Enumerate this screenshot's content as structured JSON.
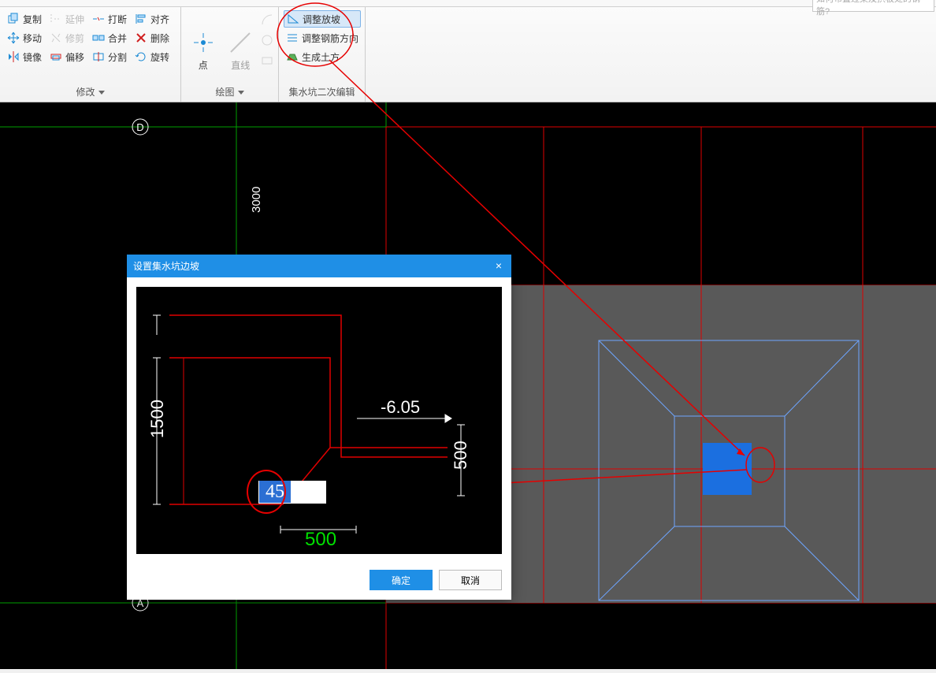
{
  "search": {
    "placeholder": "如何布置过梁及拱板处的钢筋?"
  },
  "ribbon": {
    "modify": {
      "title": "修改",
      "copy": "复制",
      "extend": "延伸",
      "break": "打断",
      "align": "对齐",
      "move": "移动",
      "trim": "修剪",
      "merge": "合并",
      "delete": "删除",
      "mirror": "镜像",
      "offset": "偏移",
      "split": "分割",
      "rotate": "旋转"
    },
    "draw": {
      "title": "绘图",
      "point": "点",
      "line": "直线"
    },
    "sump": {
      "title": "集水坑二次编辑",
      "adjust_slope": "调整放坡",
      "adjust_rebar": "调整钢筋方向",
      "generate_earth": "生成土方"
    }
  },
  "canvas": {
    "grid_d": "D",
    "grid_a": "A",
    "dim_3000": "3000"
  },
  "dialog": {
    "title": "设置集水坑边坡",
    "ok": "确定",
    "cancel": "取消",
    "input_value": "45",
    "dims": {
      "h1500": "1500",
      "w500": "500",
      "h500": "500",
      "elev": "-6.05"
    }
  },
  "colors": {
    "accent": "#1f8fe6",
    "annot": "#e60000"
  }
}
